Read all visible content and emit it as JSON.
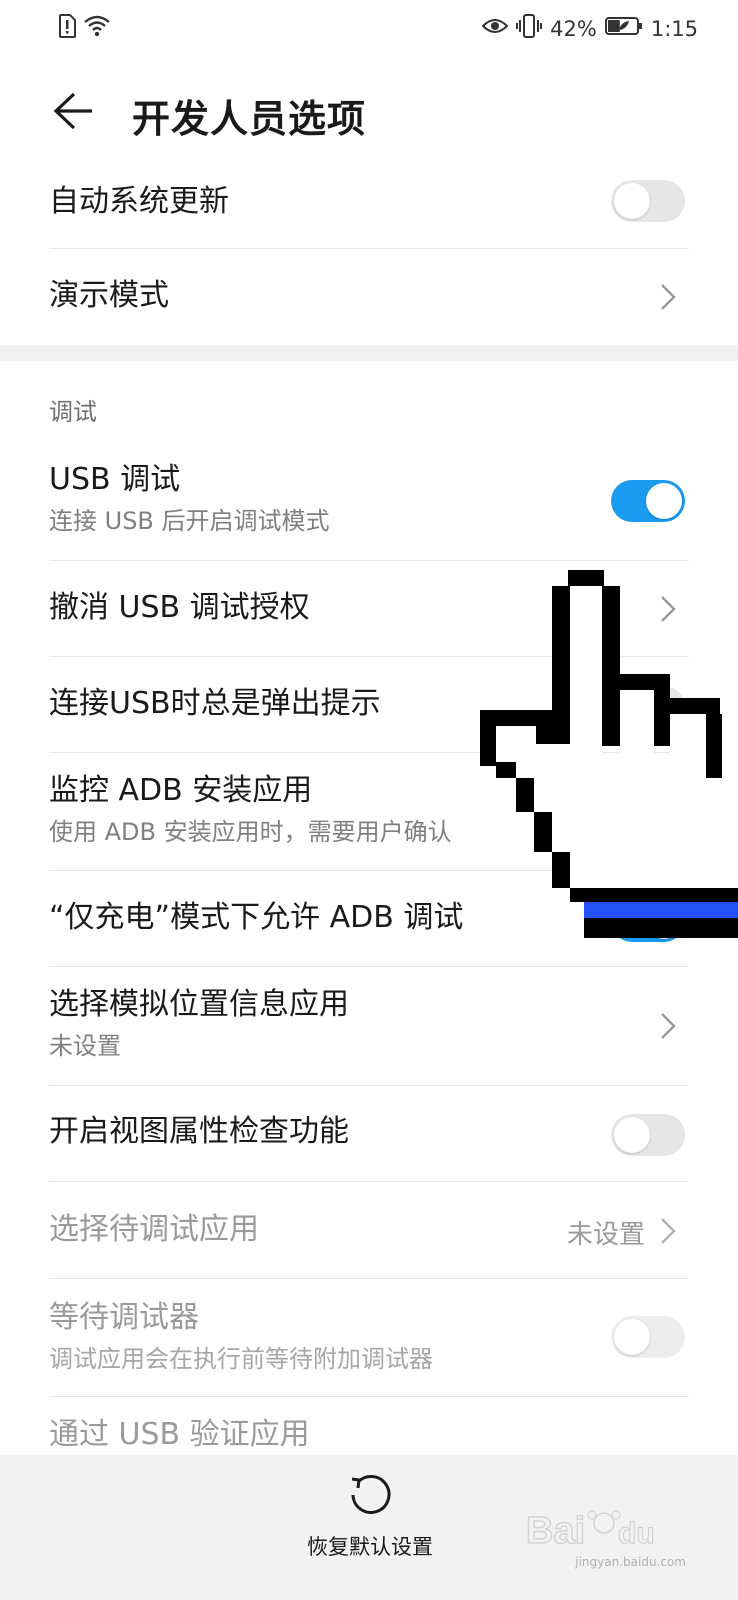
{
  "status_bar": {
    "alert_icon": "sim-alert-icon",
    "wifi_icon": "wifi-icon",
    "eye_icon": "eye-comfort-icon",
    "vibrate_icon": "vibrate-icon",
    "battery_percent": "42%",
    "battery_level": 0.42,
    "time": "1:15"
  },
  "header": {
    "back_icon": "back-arrow-icon",
    "title": "开发人员选项"
  },
  "settings_top": [
    {
      "title": "自动系统更新",
      "control": "toggle",
      "on": false
    },
    {
      "title": "演示模式",
      "control": "chevron"
    }
  ],
  "debug_section": {
    "header": "调试",
    "items": [
      {
        "title": "USB 调试",
        "subtitle": "连接 USB 后开启调试模式",
        "control": "toggle",
        "on": true
      },
      {
        "title": "撤消 USB 调试授权",
        "control": "chevron"
      },
      {
        "title": "连接USB时总是弹出提示",
        "control": "toggle",
        "on": false
      },
      {
        "title": "监控 ADB 安装应用",
        "subtitle": "使用 ADB 安装应用时，需要用户确认",
        "control": "toggle",
        "on": false
      },
      {
        "title": "“仅充电”模式下允许 ADB 调试",
        "control": "toggle",
        "on": true
      },
      {
        "title": "选择模拟位置信息应用",
        "subtitle": "未设置",
        "control": "chevron"
      },
      {
        "title": "开启视图属性检查功能",
        "control": "toggle",
        "on": false
      },
      {
        "title": "选择待调试应用",
        "value": "未设置",
        "control": "chevron",
        "disabled": true
      },
      {
        "title": "等待调试器",
        "subtitle": "调试应用会在执行前等待附加调试器",
        "control": "toggle",
        "on": false,
        "disabled": true
      },
      {
        "title": "通过 USB 验证应用",
        "control": "toggle",
        "on": false,
        "disabled": true
      }
    ]
  },
  "bottom_bar": {
    "reset_icon": "restore-icon",
    "reset_label": "恢复默认设置"
  },
  "watermark": {
    "brand": "Baidu经验",
    "url": "jingyan.baidu.com"
  },
  "colors": {
    "accent": "#1a9bf0",
    "divider": "#e4e4e4",
    "cursor_blue": "#2450f5"
  }
}
